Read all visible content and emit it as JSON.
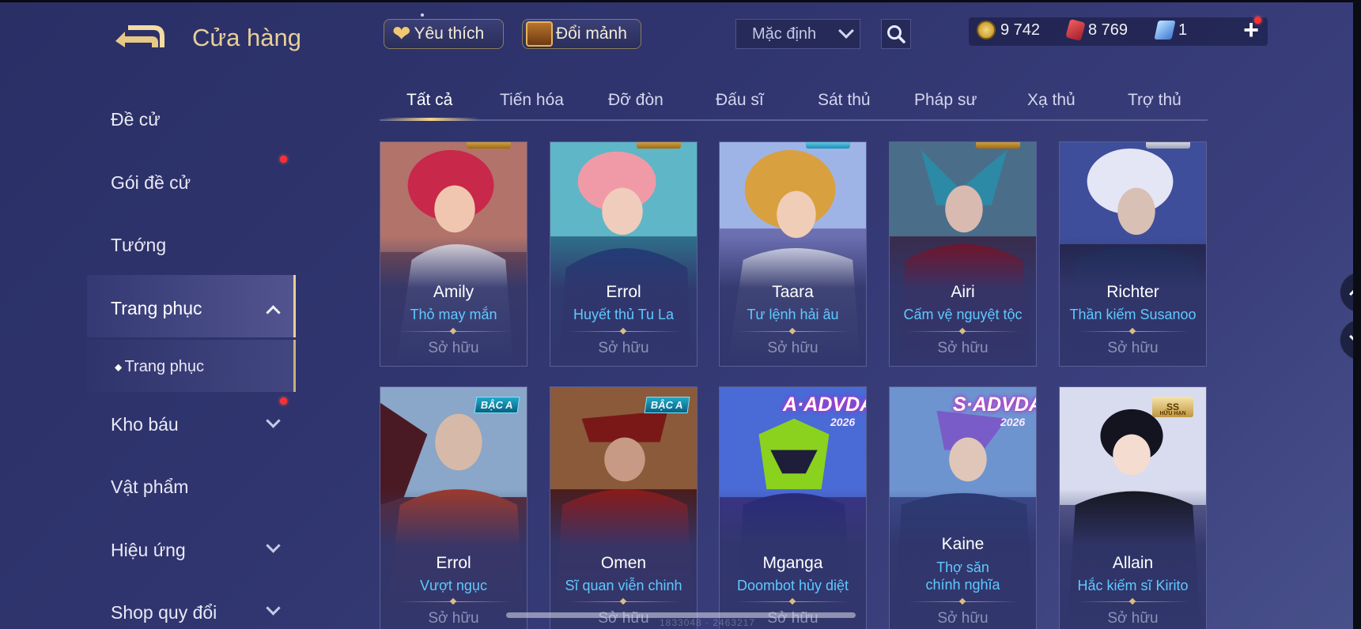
{
  "header": {
    "title": "Cửa hàng",
    "favorites_label": "Yêu thích",
    "shard_exchange_label": "Đổi mảnh",
    "sort_value": "Mặc định"
  },
  "currency": {
    "gold": "9 742",
    "vouchers": "8 769",
    "crystals": "1"
  },
  "sidebar": {
    "items": [
      {
        "label": "Đề cử"
      },
      {
        "label": "Gói đề cử"
      },
      {
        "label": "Tướng"
      },
      {
        "label": "Trang phục"
      },
      {
        "label": "Trang phục"
      },
      {
        "label": "Kho báu"
      },
      {
        "label": "Vật phẩm"
      },
      {
        "label": "Hiệu ứng"
      },
      {
        "label": "Shop quy đổi"
      }
    ]
  },
  "tabs": [
    {
      "label": "Tất cả"
    },
    {
      "label": "Tiến hóa"
    },
    {
      "label": "Đỡ đòn"
    },
    {
      "label": "Đấu sĩ"
    },
    {
      "label": "Sát thủ"
    },
    {
      "label": "Pháp sư"
    },
    {
      "label": "Xạ thủ"
    },
    {
      "label": "Trợ thủ"
    }
  ],
  "cards": [
    {
      "hero": "Amily",
      "skin": "Thỏ may mắn",
      "status": "Sở hữu",
      "badge": ""
    },
    {
      "hero": "Errol",
      "skin": "Huyết thủ Tu La",
      "status": "Sở hữu",
      "badge": ""
    },
    {
      "hero": "Taara",
      "skin": "Tư lệnh hải âu",
      "status": "Sở hữu",
      "badge": ""
    },
    {
      "hero": "Airi",
      "skin": "Cấm vệ nguyệt tộc",
      "status": "Sở hữu",
      "badge": ""
    },
    {
      "hero": "Richter",
      "skin": "Thần kiếm Susanoo",
      "status": "Sở hữu",
      "badge": ""
    },
    {
      "hero": "Errol",
      "skin": "Vượt ngục",
      "status": "Sở hữu",
      "badge": "BẬC A"
    },
    {
      "hero": "Omen",
      "skin": "Sĩ quan viễn chinh",
      "status": "Sở hữu",
      "badge": "BẬC A"
    },
    {
      "hero": "Mganga",
      "skin": "Doombot hủy diệt",
      "status": "Sở hữu",
      "badge": "A·ADVDAY",
      "badge_year": "2026"
    },
    {
      "hero": "Kaine",
      "skin": "Thợ săn chính nghĩa",
      "status": "Sở hữu",
      "badge": "S·ADVDAY",
      "badge_year": "2026"
    },
    {
      "hero": "Allain",
      "skin": "Hắc kiếm sĩ Kirito",
      "status": "Sở hữu",
      "badge": "SS",
      "badge_sub": "HỮU HẠN"
    }
  ],
  "footer_faint_text": "1833048 · 2463217",
  "colors": {
    "accent_gold": "#e8cf98",
    "skin_name": "#5fc9ff",
    "notification": "#ff3030",
    "background": "#30356f"
  },
  "icons": {
    "back": "back-arrow-icon",
    "favorites": "heart-icon",
    "shards": "treasure-chest-icon",
    "sort": "chevron-down-icon",
    "search": "search-icon",
    "gold": "gold-coin-icon",
    "vouchers": "voucher-gem-icon",
    "crystals": "crystal-icon",
    "add": "plus-icon"
  }
}
